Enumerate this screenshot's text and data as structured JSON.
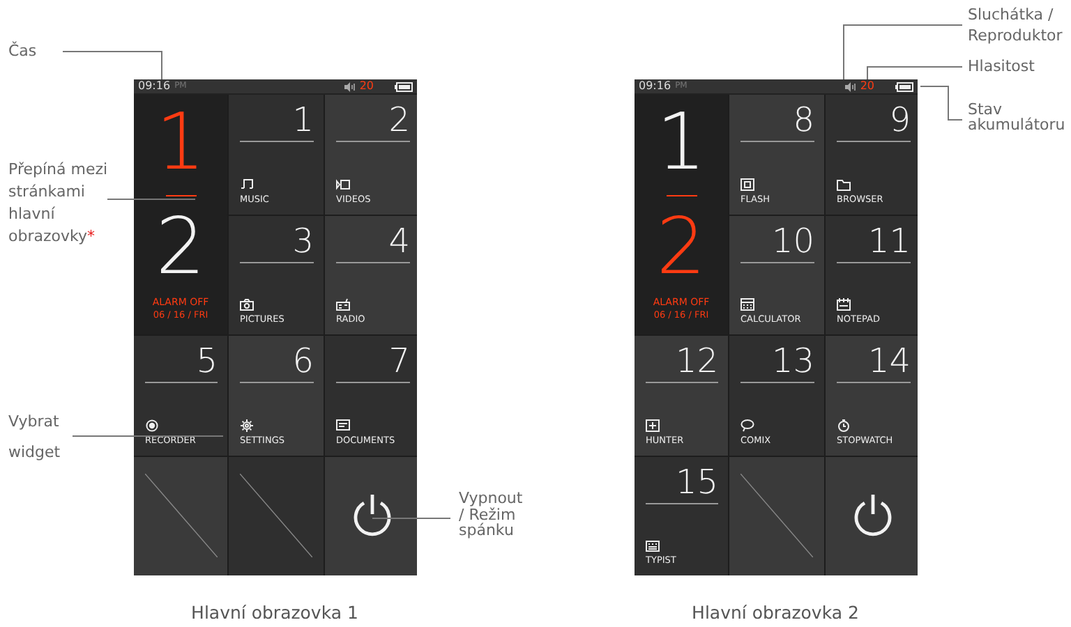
{
  "annotations": [
    {
      "text": "Čas"
    },
    {
      "text": "Přepíná mezi stránkami hlavní obrazovky",
      "mark": "*"
    },
    {
      "text": "Vybrat widget"
    },
    {
      "text": "Vypnout / Režim spánku"
    },
    {
      "text": "Sluchátka / Reproduktor"
    },
    {
      "text": "Hlasitost"
    },
    {
      "text": "Stav akumulátoru"
    }
  ],
  "screens": [
    {
      "time": "09:16",
      "ampm": "PM",
      "volume": "20",
      "pages": [
        {
          "label": "1",
          "selected": true
        },
        {
          "label": "2",
          "selected": false
        }
      ],
      "alarm": "ALARM OFF",
      "date": "06 / 16 / FRI",
      "caption": "Hlavní obrazovka 1",
      "tiles": [
        {
          "kind": "music",
          "number": "1",
          "label": "MUSIC"
        },
        {
          "kind": "video",
          "number": "2",
          "label": "VIDEOS"
        },
        {
          "kind": "camera",
          "number": "3",
          "label": "PICTURES"
        },
        {
          "kind": "radio",
          "number": "4",
          "label": "RADIO"
        },
        {
          "kind": "record",
          "number": "5",
          "label": "RECORDER"
        },
        {
          "kind": "gear",
          "number": "6",
          "label": "SETTINGS"
        },
        {
          "kind": "document",
          "number": "7",
          "label": "DOCUMENTS"
        },
        {
          "kind": "empty"
        },
        {
          "kind": "empty"
        },
        {
          "kind": "power"
        }
      ]
    },
    {
      "time": "09:16",
      "ampm": "PM",
      "volume": "20",
      "pages": [
        {
          "label": "1",
          "selected": false
        },
        {
          "label": "2",
          "selected": true
        }
      ],
      "alarm": "ALARM OFF",
      "date": "06 / 16 / FRI",
      "caption": "Hlavní obrazovka 2",
      "tiles": [
        {
          "kind": "flash",
          "number": "8",
          "label": "FLASH"
        },
        {
          "kind": "folder",
          "number": "9",
          "label": "BROWSER"
        },
        {
          "kind": "calculator",
          "number": "10",
          "label": "CALCULATOR"
        },
        {
          "kind": "notepad",
          "number": "11",
          "label": "NOTEPAD"
        },
        {
          "kind": "hunter",
          "number": "12",
          "label": "HUNTER"
        },
        {
          "kind": "bubble",
          "number": "13",
          "label": "COMIX"
        },
        {
          "kind": "stopwatch",
          "number": "14",
          "label": "STOPWATCH"
        },
        {
          "kind": "keyboard",
          "number": "15",
          "label": "TYPIST"
        },
        {
          "kind": "empty"
        },
        {
          "kind": "power"
        }
      ]
    }
  ]
}
